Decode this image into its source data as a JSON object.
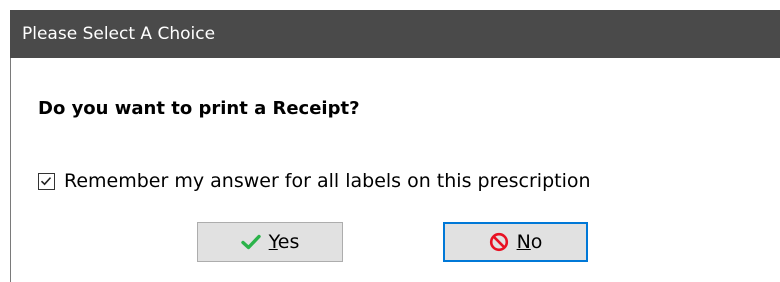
{
  "window": {
    "title": "Please Select A Choice"
  },
  "prompt": {
    "question": "Do you want to print a Receipt?"
  },
  "remember": {
    "label": "Remember my answer for all labels on this prescription",
    "checked": true
  },
  "buttons": {
    "yes": {
      "mnemonic": "Y",
      "rest": "es",
      "icon": "checkmark-icon",
      "icon_color": "#2bb34a"
    },
    "no": {
      "mnemonic": "N",
      "rest": "o",
      "icon": "no-entry-icon",
      "icon_color": "#e81123",
      "focused": true
    }
  },
  "colors": {
    "titlebar": "#4a4a4a",
    "focus_border": "#0078d7"
  }
}
